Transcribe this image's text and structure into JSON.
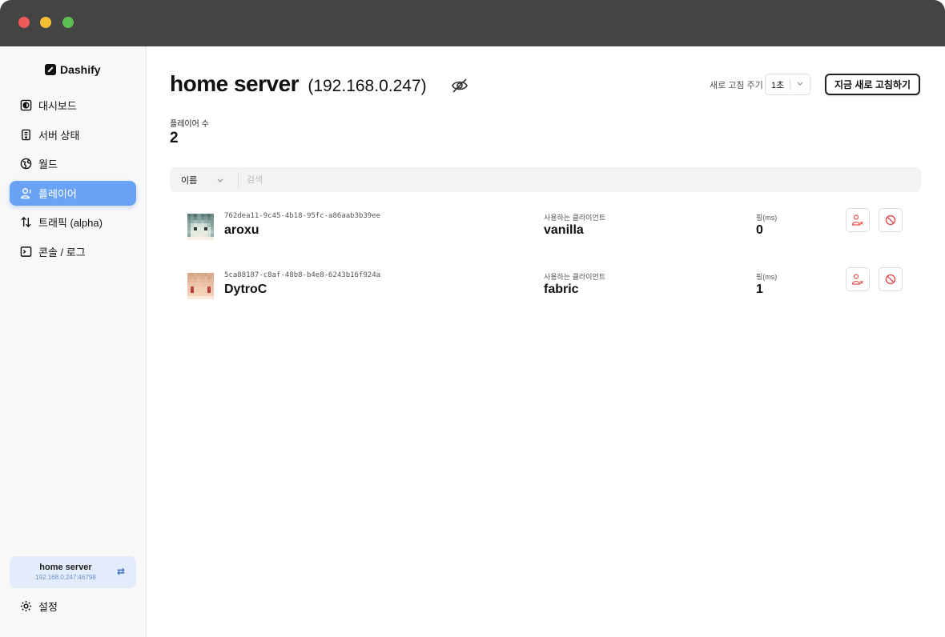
{
  "app": {
    "brand": "Dashify"
  },
  "sidebar": {
    "items": [
      {
        "label": "대시보드",
        "icon": "dashboard-icon"
      },
      {
        "label": "서버 상태",
        "icon": "server-icon"
      },
      {
        "label": "월드",
        "icon": "globe-icon"
      },
      {
        "label": "플레이어",
        "icon": "user-icon",
        "active": true
      },
      {
        "label": "트래픽 (alpha)",
        "icon": "arrows-updown-icon"
      },
      {
        "label": "콘솔 / 로그",
        "icon": "terminal-icon"
      }
    ],
    "server": {
      "name": "home server",
      "address": "192.168.0.247:46798"
    },
    "settings_label": "설정"
  },
  "header": {
    "title": "home server",
    "ip": "(192.168.0.247)",
    "refresh_label": "새로 고침 주기",
    "refresh_value": "1초",
    "refresh_now": "지금 새로 고침하기"
  },
  "stats": {
    "player_count_label": "플레이어 수",
    "player_count": "2"
  },
  "filter": {
    "field": "이름",
    "search_placeholder": "검색"
  },
  "players": [
    {
      "uuid": "762dea11-9c45-4b18-95fc-a86aab3b39ee",
      "name": "aroxu",
      "client_label": "사용하는 클라이언트",
      "client": "vanilla",
      "ping_label": "핑(ms)",
      "ping": "0"
    },
    {
      "uuid": "5ca88187-c8af-48b8-b4e8-6243b16f924a",
      "name": "DytroC",
      "client_label": "사용하는 클라이언트",
      "client": "fabric",
      "ping_label": "핑(ms)",
      "ping": "1"
    }
  ],
  "colors": {
    "accent": "#6aa3f5",
    "titlebar": "#444444",
    "danger": "#e05555"
  }
}
